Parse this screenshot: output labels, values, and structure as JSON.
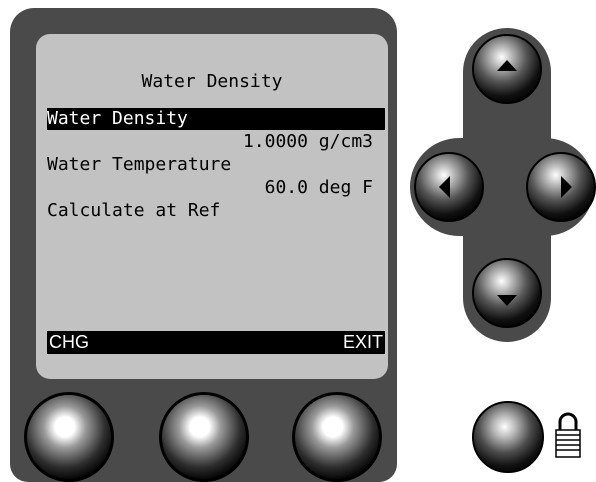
{
  "screen": {
    "title": "Water Density",
    "items": [
      {
        "label": "Water Density",
        "value": "1.0000 g/cm3",
        "selected": true
      },
      {
        "label": "Water Temperature",
        "value": "60.0 deg F",
        "selected": false
      },
      {
        "label": "Calculate at Ref",
        "value": "",
        "selected": false
      }
    ],
    "softkeys": {
      "left": "CHG",
      "right": "EXIT"
    }
  },
  "icons": {
    "up": "triangle-up-icon",
    "down": "triangle-down-icon",
    "left": "triangle-left-icon",
    "right": "triangle-right-icon",
    "lock": "padlock-icon"
  },
  "colors": {
    "bezel": "#4a4a4a",
    "screen": "#c2c2c2",
    "highlight": "#000000",
    "highlight_text": "#ffffff"
  }
}
